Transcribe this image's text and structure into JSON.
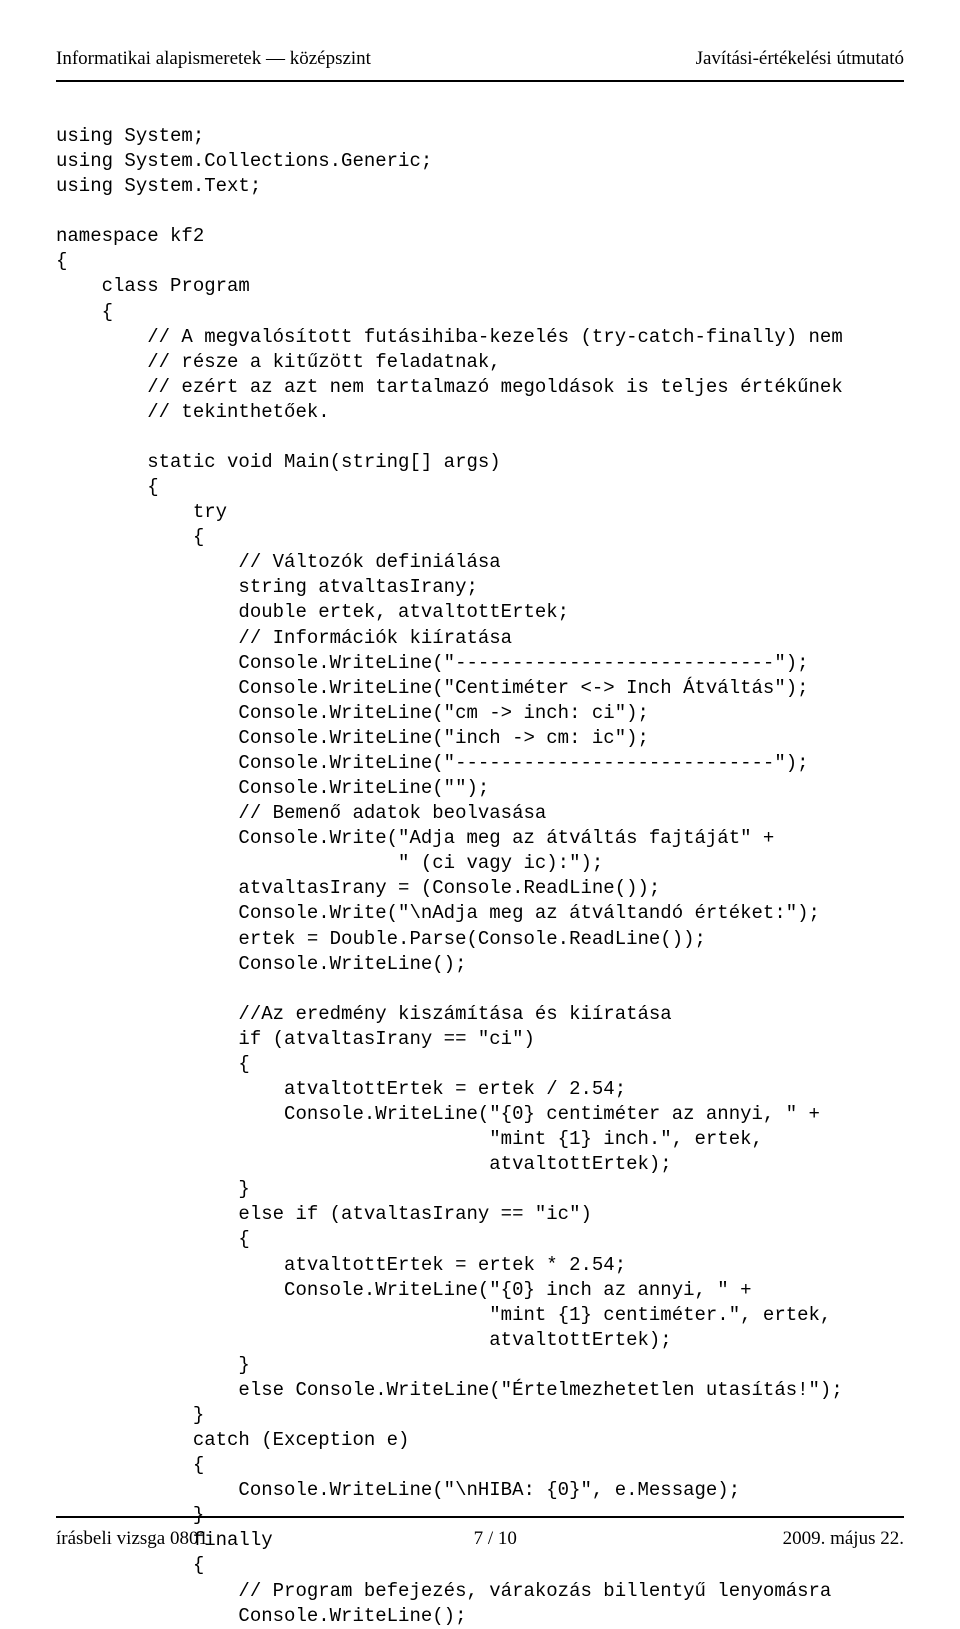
{
  "header": {
    "left": "Informatikai alapismeretek — középszint",
    "right": "Javítási-értékelési útmutató"
  },
  "code": "using System;\nusing System.Collections.Generic;\nusing System.Text;\n\nnamespace kf2\n{\n    class Program\n    {\n        // A megvalósított futásihiba-kezelés (try-catch-finally) nem\n        // része a kitűzött feladatnak,\n        // ezért az azt nem tartalmazó megoldások is teljes értékűnek\n        // tekinthetőek.\n\n        static void Main(string[] args)\n        {\n            try\n            {\n                // Változók definiálása\n                string atvaltasIrany;\n                double ertek, atvaltottErtek;\n                // Információk kiíratása\n                Console.WriteLine(\"----------------------------\");\n                Console.WriteLine(\"Centiméter <-> Inch Átváltás\");\n                Console.WriteLine(\"cm -> inch: ci\");\n                Console.WriteLine(\"inch -> cm: ic\");\n                Console.WriteLine(\"----------------------------\");\n                Console.WriteLine(\"\");\n                // Bemenő adatok beolvasása\n                Console.Write(\"Adja meg az átváltás fajtáját\" +\n                              \" (ci vagy ic):\");\n                atvaltasIrany = (Console.ReadLine());\n                Console.Write(\"\\nAdja meg az átváltandó értéket:\");\n                ertek = Double.Parse(Console.ReadLine());\n                Console.WriteLine();\n\n                //Az eredmény kiszámítása és kiíratása\n                if (atvaltasIrany == \"ci\")\n                {\n                    atvaltottErtek = ertek / 2.54;\n                    Console.WriteLine(\"{0} centiméter az annyi, \" +\n                                      \"mint {1} inch.\", ertek,\n                                      atvaltottErtek);\n                }\n                else if (atvaltasIrany == \"ic\")\n                {\n                    atvaltottErtek = ertek * 2.54;\n                    Console.WriteLine(\"{0} inch az annyi, \" +\n                                      \"mint {1} centiméter.\", ertek,\n                                      atvaltottErtek);\n                }\n                else Console.WriteLine(\"Értelmezhetetlen utasítás!\");\n            }\n            catch (Exception e)\n            {\n                Console.WriteLine(\"\\nHIBA: {0}\", e.Message);\n            }\n            finally\n            {\n                // Program befejezés, várakozás billentyű lenyomásra\n                Console.WriteLine();",
  "footer": {
    "left": "írásbeli vizsga 0801",
    "center": "7 / 10",
    "right": "2009. május 22."
  }
}
